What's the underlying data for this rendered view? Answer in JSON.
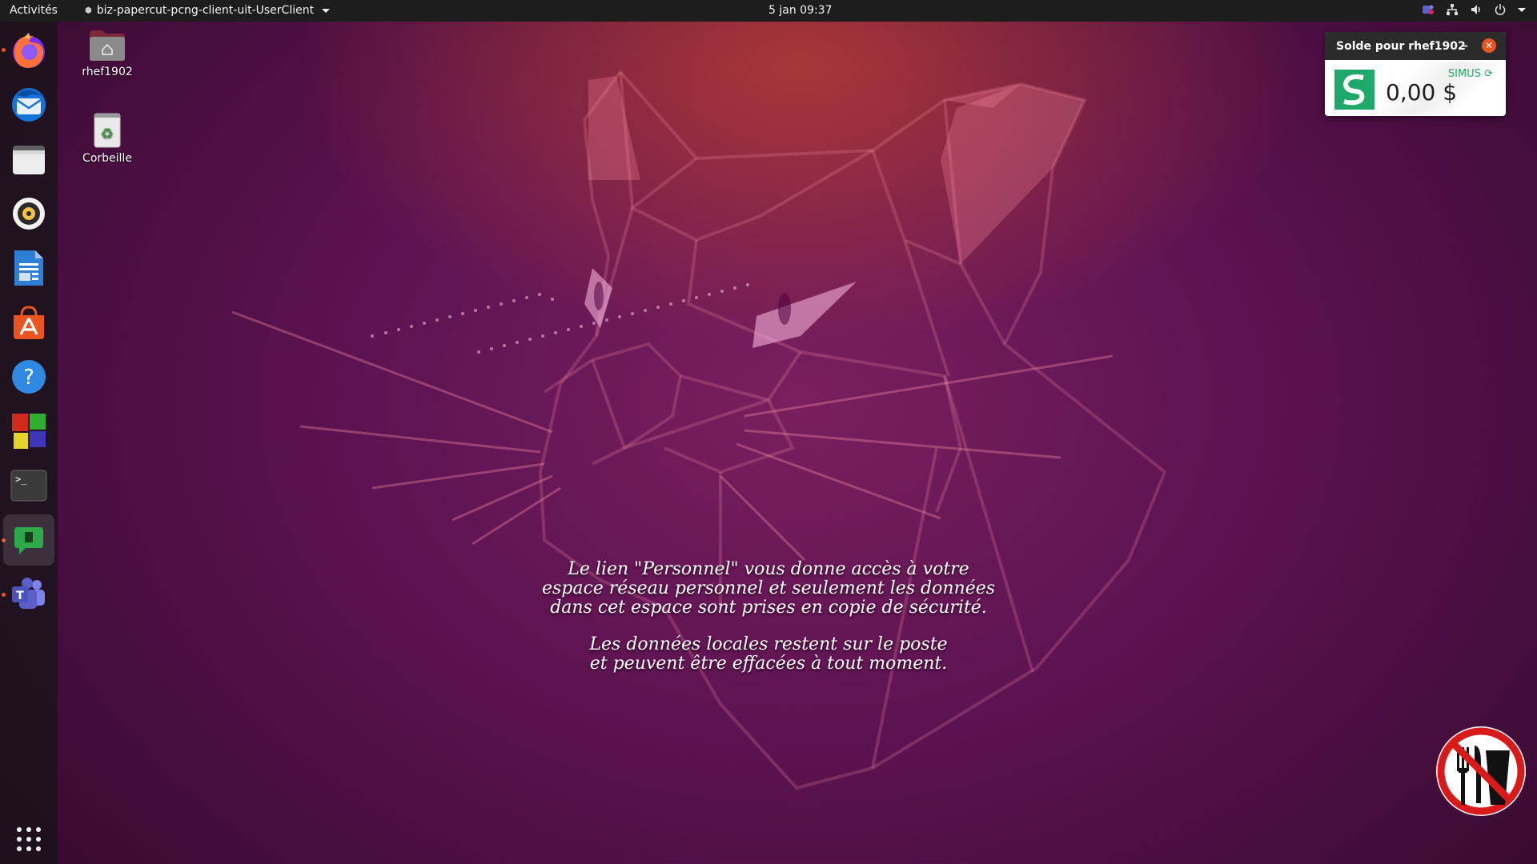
{
  "topbar": {
    "activities": "Activités",
    "app_menu": "biz-papercut-pcng-client-uit-UserClient",
    "clock": "5 jan  09:37"
  },
  "dock": {
    "items": [
      {
        "name": "firefox",
        "icon": "firefox-icon"
      },
      {
        "name": "thunderbird",
        "icon": "thunderbird-icon"
      },
      {
        "name": "files",
        "icon": "files-icon"
      },
      {
        "name": "rhythmbox",
        "icon": "rhythmbox-icon"
      },
      {
        "name": "libreoffice-writer",
        "icon": "writer-icon"
      },
      {
        "name": "software-center",
        "icon": "software-center-icon"
      },
      {
        "name": "help",
        "icon": "help-icon"
      },
      {
        "name": "colorful-app",
        "icon": "colorful-squares-icon"
      },
      {
        "name": "terminal",
        "icon": "terminal-icon"
      },
      {
        "name": "papercut",
        "icon": "papercut-icon"
      },
      {
        "name": "teams",
        "icon": "teams-icon"
      }
    ],
    "show_apps": "apps-grid-icon"
  },
  "desktop": {
    "home_label": "rhef1902",
    "trash_label": "Corbeille"
  },
  "wallpaper": {
    "line1": "Le lien \"Personnel\" vous donne accès à votre",
    "line2": "espace réseau personnel et seulement les données",
    "line3": "dans cet espace sont prises en copie de sécurité.",
    "line4": "Les données locales restent sur le poste",
    "line5": "et peuvent être effacées à tout moment."
  },
  "balance_widget": {
    "title": "Solde pour rhef1902",
    "minimize": "–",
    "close": "✕",
    "org": "SIMUS",
    "amount": "0,00 $",
    "accent": "#1fa86b"
  },
  "colors": {
    "ubuntu_orange": "#e95420",
    "topbar_bg": "#1d1d1d"
  }
}
